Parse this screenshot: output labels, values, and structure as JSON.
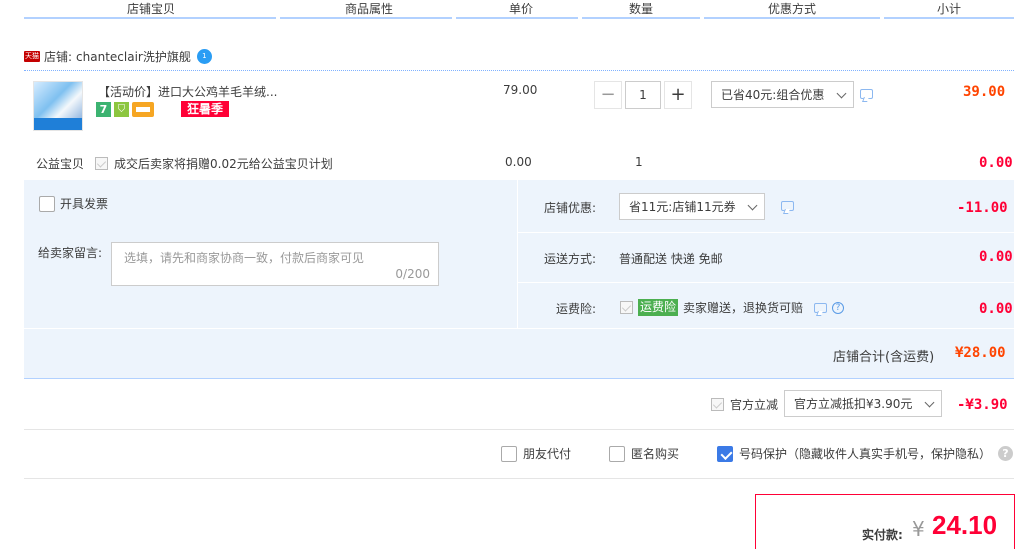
{
  "header": {
    "columns": [
      "店铺宝贝",
      "商品属性",
      "单价",
      "数量",
      "优惠方式",
      "小计"
    ]
  },
  "shop": {
    "badge": "天猫",
    "label": "店铺:",
    "name": "chanteclair洗护旗舰",
    "ww_label": "1"
  },
  "item": {
    "title": "【活动价】进口大公鸡羊毛羊绒...",
    "badge_7": "7",
    "badge_promo": "狂暑季",
    "unit_price": "79.00",
    "quantity": "1",
    "discount_select": "已省40元:组合优惠",
    "subtotal": "39.00"
  },
  "charity": {
    "label": "公益宝贝",
    "text": "成交后卖家将捐赠0.02元给公益宝贝计划",
    "price": "0.00",
    "quantity": "1",
    "subtotal": "0.00"
  },
  "invoice": {
    "label": "开具发票"
  },
  "message": {
    "label": "给卖家留言:",
    "placeholder": "选填，请先和商家协商一致，付款后商家可见",
    "counter": "0/200"
  },
  "shop_discount": {
    "label": "店铺优惠:",
    "select": "省11元:店铺11元券",
    "amount": "-11.00"
  },
  "shipping": {
    "label": "运送方式:",
    "value": "普通配送 快递 免邮",
    "amount": "0.00"
  },
  "insurance": {
    "label": "运费险:",
    "tag": "运费险",
    "text": "卖家赠送，退换货可赔",
    "amount": "0.00"
  },
  "shop_total": {
    "label": "店铺合计(含运费)",
    "amount": "¥28.00"
  },
  "official": {
    "label": "官方立减",
    "select": "官方立减抵扣¥3.90元",
    "amount": "-¥3.90"
  },
  "options": {
    "friend_pay": "朋友代付",
    "anonymous": "匿名购买",
    "number_protect": "号码保护（隐藏收件人真实手机号，保护隐私）",
    "help": "?"
  },
  "payment": {
    "label": "实付款:",
    "currency": "¥",
    "amount": "24.10"
  },
  "colors": {
    "accent_red": "#ff0036",
    "panel_blue": "#edf4fc",
    "line_blue": "#b2d1ff",
    "checkbox_blue": "#3b7ae6"
  }
}
